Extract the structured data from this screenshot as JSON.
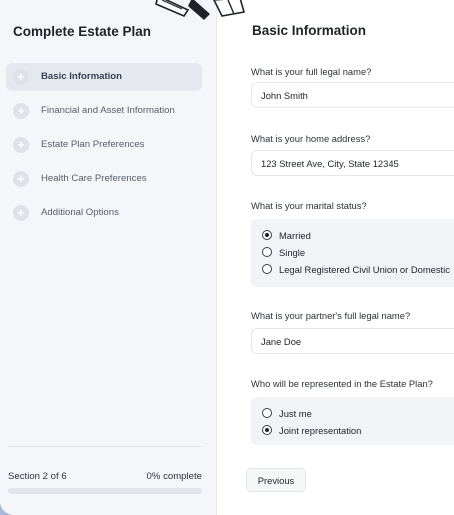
{
  "sidebar": {
    "title": "Complete Estate Plan",
    "steps": [
      {
        "label": "Basic Information",
        "active": true
      },
      {
        "label": "Financial and Asset Information",
        "active": false
      },
      {
        "label": "Estate Plan Preferences",
        "active": false
      },
      {
        "label": "Health Care Preferences",
        "active": false
      },
      {
        "label": "Additional Options",
        "active": false
      }
    ],
    "step_icon": "plus-icon",
    "section_text": "Section 2 of 6",
    "percent_text": "0% complete",
    "progress": 0
  },
  "main": {
    "title": "Basic Information",
    "questions": {
      "full_name": {
        "label": "What is your full legal name?",
        "value": "John Smith"
      },
      "address": {
        "label": "What is your home address?",
        "value": "123 Street Ave, City, State 12345"
      },
      "marital": {
        "label": "What is your marital status?",
        "options": [
          "Married",
          "Single",
          "Legal Registered Civil Union or Domestic"
        ],
        "selected": "Married"
      },
      "partner_name": {
        "label": "What is your partner's full legal name?",
        "value": "Jane Doe"
      },
      "represented": {
        "label": "Who will be represented in the Estate Plan?",
        "options": [
          "Just me",
          "Joint representation"
        ],
        "selected": "Joint representation"
      }
    },
    "previous_label": "Previous"
  },
  "colors": {
    "accent": "#3b82f6",
    "backdrop": "#a9b6de",
    "sidebar_bg": "#f5f6f9"
  }
}
